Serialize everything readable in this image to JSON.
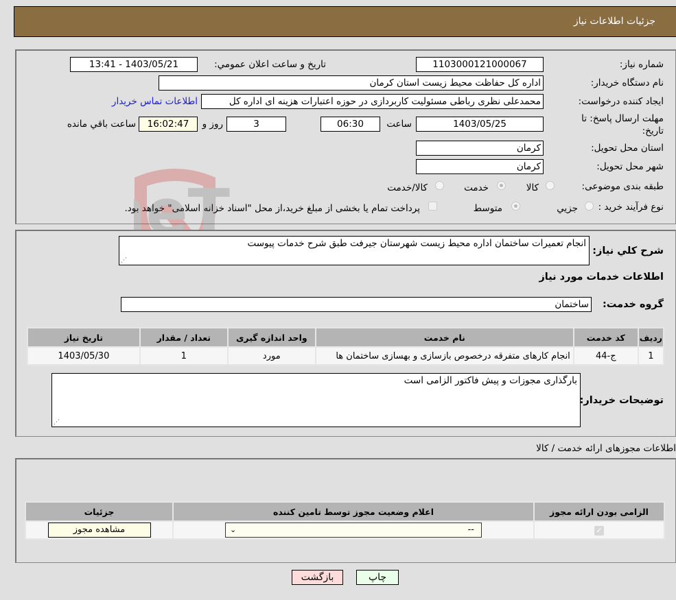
{
  "header": {
    "title": "جزئیات اطلاعات نیاز"
  },
  "details": {
    "need_number_label": "شماره نیاز:",
    "need_number": "1103000121000067",
    "announce_label": "تاریخ و ساعت اعلان عمومي:",
    "announce_value": "1403/05/21 - 13:41",
    "buyer_org_label": "نام دستگاه خریدار:",
    "buyer_org": "اداره کل حفاظت محیط زیست استان کرمان",
    "creator_label": "ایجاد کننده درخواست:",
    "creator": "محمدعلی نظری رباطی مسئولیت کاربردازی در حوزه اعتبارات هزینه ای اداره کل",
    "contact_link": "اطلاعات تماس خریدار",
    "deadline_label": "مهلت ارسال پاسخ: تا تاریخ:",
    "deadline_date": "1403/05/25",
    "time_label": "ساعت",
    "deadline_time": "06:30",
    "days_value": "3",
    "days_label": "روز و",
    "remaining_time": "16:02:47",
    "remaining_label": "ساعت باقي مانده",
    "province_label": "استان محل تحویل:",
    "province": "کرمان",
    "city_label": "شهر محل تحویل:",
    "city": "کرمان",
    "category_label": "طبقه بندی موضوعی:",
    "category_options": [
      "کالا",
      "خدمت",
      "کالا/خدمت"
    ],
    "category_selected": "خدمت",
    "process_label": "نوع فرآیند خرید :",
    "process_options": [
      "جزيي",
      "متوسط"
    ],
    "process_selected": "متوسط",
    "payment_note": "پرداخت تمام یا بخشی از مبلغ خرید،از محل \"اسناد خزانه اسلامی\" خواهد بود."
  },
  "summary": {
    "description_label": "شرح کلي نياز:",
    "description": "انجام تعمیرات ساختمان اداره محیط زیست شهرستان جیرفت طبق شرح خدمات پیوست",
    "services_heading": "اطلاعات خدمات مورد نیاز",
    "service_group_label": "گروه خدمت:",
    "service_group": "ساختمان",
    "table": {
      "headers": [
        "رديف",
        "کد خدمت",
        "نام خدمت",
        "واحد اندازه گیری",
        "تعداد / مقدار",
        "تاریخ نیاز"
      ],
      "rows": [
        [
          "1",
          "ج-44",
          "انجام کارهای متفرقه درخصوص بازسازی و بهسازی ساختمان ها",
          "مورد",
          "1",
          "1403/05/30"
        ]
      ]
    },
    "buyer_notes_label": "توضیحات خریدار:",
    "buyer_notes": "بارگذاری مجوزات و پیش فاکتور الزامی است"
  },
  "permits": {
    "heading": "اطلاعات مجوزهای ارائه خدمت / کالا",
    "headers": [
      "الزامی بودن ارائه مجوز",
      "اعلام وضعیت مجوز توسط تامین کننده",
      "جزئیات"
    ],
    "row": {
      "required_checked": true,
      "status_select": "--",
      "details_button": "مشاهده مجوز"
    }
  },
  "footer": {
    "print_label": "چاپ",
    "back_label": "بازگشت"
  },
  "colors": {
    "header_bg": "#8b6d42",
    "print_bg": "#eaffea",
    "back_bg": "#ffdcdc",
    "link": "#1a1adf"
  },
  "watermark": {
    "text": "AriaTender.neT"
  }
}
